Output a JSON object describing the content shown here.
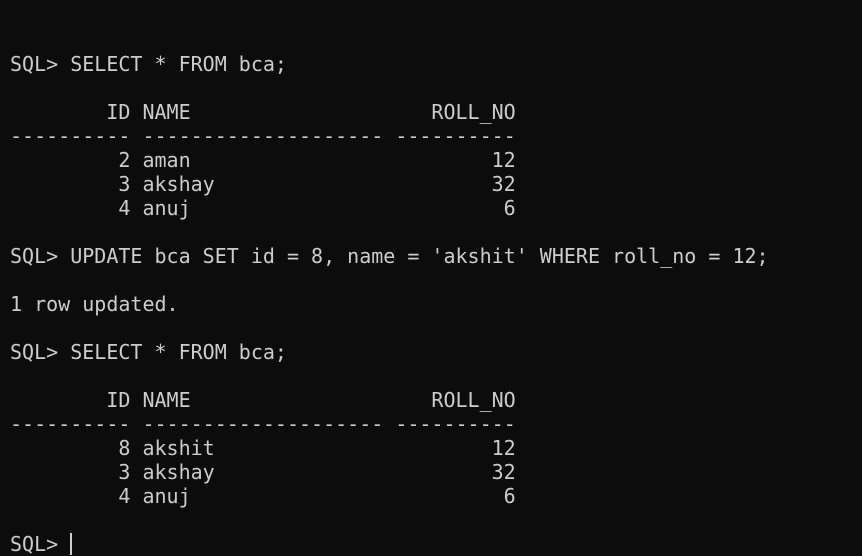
{
  "terminal": {
    "lines": [
      "",
      "SQL> SELECT * FROM bca;",
      "",
      "        ID NAME                    ROLL_NO",
      "---------- -------------------- ----------",
      "         2 aman                         12",
      "         3 akshay                       32",
      "         4 anuj                          6",
      "",
      "SQL> UPDATE bca SET id = 8, name = 'akshit' WHERE roll_no = 12;",
      "",
      "1 row updated.",
      "",
      "SQL> SELECT * FROM bca;",
      "",
      "        ID NAME                    ROLL_NO",
      "---------- -------------------- ----------",
      "         8 akshit                       12",
      "         3 akshay                       32",
      "         4 anuj                          6",
      ""
    ],
    "prompt": "SQL> "
  },
  "colors": {
    "background": "#0c0c0c",
    "foreground": "#cccccc"
  }
}
